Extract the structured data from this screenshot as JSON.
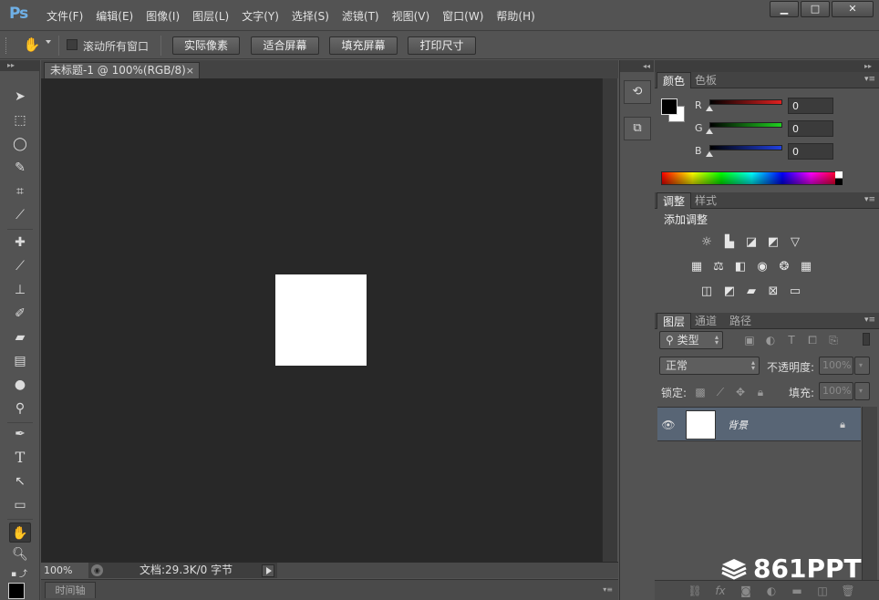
{
  "app": {
    "logo": "Ps"
  },
  "menubar": {
    "items": [
      "文件(F)",
      "编辑(E)",
      "图像(I)",
      "图层(L)",
      "文字(Y)",
      "选择(S)",
      "滤镜(T)",
      "视图(V)",
      "窗口(W)",
      "帮助(H)"
    ],
    "window_buttons": [
      "▁",
      "□",
      "✕"
    ]
  },
  "options": {
    "scroll_all_label": "滚动所有窗口",
    "buttons": [
      "实际像素",
      "适合屏幕",
      "填充屏幕",
      "打印尺寸"
    ]
  },
  "document": {
    "tab_title": "未标题-1 @ 100%(RGB/8)",
    "close": "×",
    "zoom": "100%",
    "doc_info": "文档:29.3K/0 字节",
    "timeline_label": "时间轴"
  },
  "color_panel": {
    "tabs": [
      "颜色",
      "色板"
    ],
    "channels": [
      {
        "label": "R",
        "value": "0",
        "color": "#e02020"
      },
      {
        "label": "G",
        "value": "0",
        "color": "#20d020"
      },
      {
        "label": "B",
        "value": "0",
        "color": "#2040e0"
      }
    ],
    "foreground": "#000000",
    "background": "#ffffff"
  },
  "adjustments_panel": {
    "tabs": [
      "调整",
      "样式"
    ],
    "add_label": "添加调整"
  },
  "layers_panel": {
    "tabs": [
      "图层",
      "通道",
      "路径"
    ],
    "filter_kind": "类型",
    "blend_mode": "正常",
    "opacity_label": "不透明度:",
    "opacity_value": "100%",
    "lock_label": "锁定:",
    "fill_label": "填充:",
    "fill_value": "100%",
    "layers": [
      {
        "name": "背景",
        "locked": true,
        "visible": true
      }
    ]
  },
  "watermark": {
    "text": "861PPT"
  }
}
